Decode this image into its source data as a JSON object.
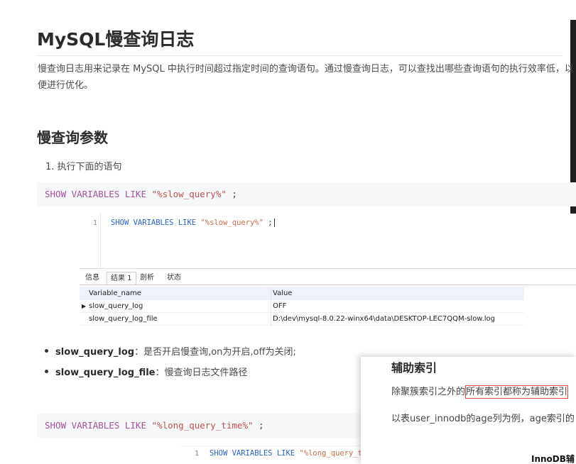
{
  "article": {
    "title": "MySQL慢查询日志",
    "intro": "慢查询日志用来记录在 MySQL 中执行时间超过指定时间的查询语句。通过慢查询日志，可以查找出哪些查询语句的执行效率低，以便进行优化。",
    "section_title": "慢查询参数",
    "step1": "1. 执行下面的语句",
    "code1_kw": "SHOW VARIABLES LIKE ",
    "code1_str": "\"%slow_query%\"",
    "code1_tail": " ;",
    "code2_kw": "SHOW VARIABLES LIKE ",
    "code2_str": "\"%long_query_time%\"",
    "code2_tail": " ;",
    "bullets": [
      {
        "term": "slow_query_log",
        "desc": "：是否开启慢查询,on为开启,off为关闭;"
      },
      {
        "term": "slow_query_log_file",
        "desc": "：慢查询日志文件路径"
      }
    ]
  },
  "sql_tool": {
    "line_number": "1",
    "query_kw": "SHOW VARIABLES LIKE ",
    "query_str": "\"%slow_query%\"",
    "query_tail": " ;",
    "tabs": [
      "信息",
      "结果 1",
      "剖析",
      "状态"
    ],
    "columns": [
      "Variable_name",
      "Value"
    ],
    "rows": [
      [
        "slow_query_log",
        "OFF"
      ],
      [
        "slow_query_log_file",
        "D:\\dev\\mysql-8.0.22-winx64\\data\\DESKTOP-LEC7QQM-slow.log"
      ]
    ]
  },
  "sql_tool2": {
    "line_number": "1",
    "query_kw": "SHOW VARIABLES LIKE ",
    "query_str": "\"%long_query_t"
  },
  "overlay": {
    "title": "辅助索引",
    "line1_prefix": "除聚簇索引之外的",
    "line1_highlight": "所有索引都称为辅助索引",
    "line2": "以表user_innodb的age列为例，age索引的",
    "caption": "InnoDB辅"
  }
}
